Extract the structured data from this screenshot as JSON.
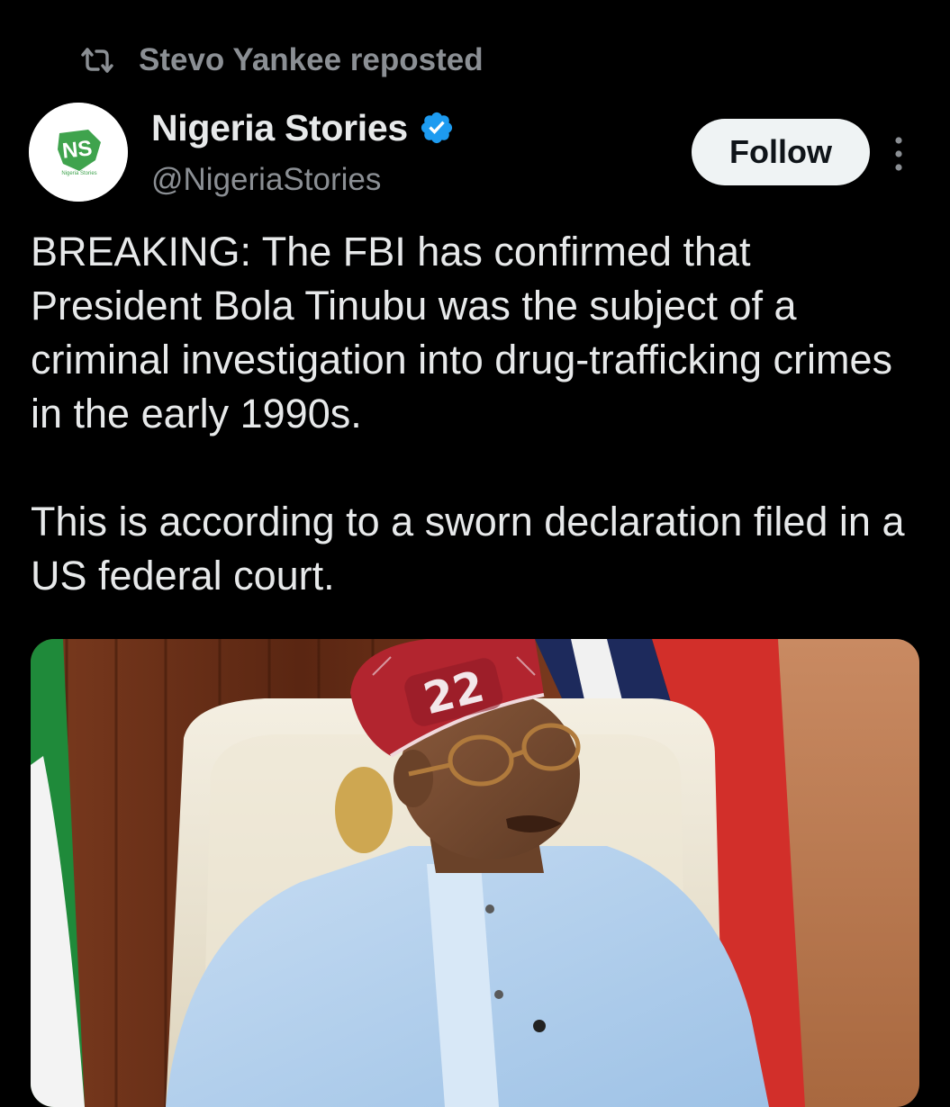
{
  "repost": {
    "text": "Stevo Yankee reposted",
    "icon": "repost-icon"
  },
  "author": {
    "display_name": "Nigeria Stories",
    "handle": "@NigeriaStories",
    "verified": true,
    "verified_icon": "verified-badge-icon",
    "avatar_text": "NS",
    "avatar_subtext": "Nigeria Stories"
  },
  "actions": {
    "follow_label": "Follow",
    "more_icon": "more-vertical-icon"
  },
  "tweet": {
    "paragraph_1": "BREAKING: The FBI has confirmed that President Bola Tinubu was the subject of a criminal investigation into drug-trafficking crimes in the early 1990s.",
    "paragraph_2": "This is according to a sworn declaration filed in a US federal court."
  },
  "media": {
    "type": "photo",
    "cap_text": "22"
  },
  "colors": {
    "background": "#000000",
    "text_primary": "#e7e9ea",
    "text_secondary": "#8b8f94",
    "verified_blue": "#1d9bf0",
    "follow_bg": "#eff3f4",
    "brand_green": "#3fa34d"
  }
}
